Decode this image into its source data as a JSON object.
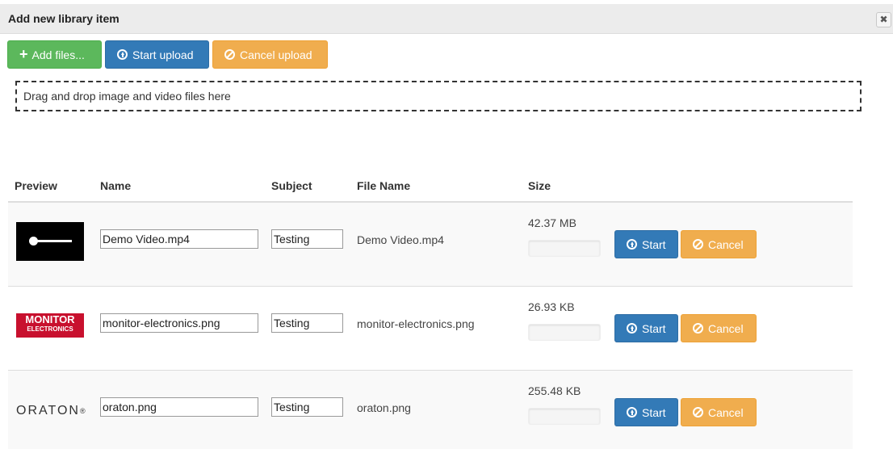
{
  "dialog": {
    "title": "Add new library item",
    "close_glyph": "✖"
  },
  "toolbar": {
    "add_files_label": "Add files...",
    "start_upload_label": "Start upload",
    "cancel_upload_label": "Cancel upload"
  },
  "dropzone": {
    "text": "Drag and drop image and video files here"
  },
  "table": {
    "headers": {
      "preview": "Preview",
      "name": "Name",
      "subject": "Subject",
      "file_name": "File Name",
      "size": "Size"
    },
    "rows": [
      {
        "preview": "video-thumbnail",
        "name": "Demo Video.mp4",
        "subject": "Testing",
        "file_name": "Demo Video.mp4",
        "size": "42.37 MB",
        "progress": 0,
        "start_label": "Start",
        "cancel_label": "Cancel"
      },
      {
        "preview": "monitor-electronics-logo",
        "preview_line1": "MONITOR",
        "preview_line2": "ELECTRONICS",
        "name": "monitor-electronics.png",
        "subject": "Testing",
        "file_name": "monitor-electronics.png",
        "size": "26.93 KB",
        "progress": 0,
        "start_label": "Start",
        "cancel_label": "Cancel"
      },
      {
        "preview": "oraton-logo",
        "preview_text": "ORATON",
        "name": "oraton.png",
        "subject": "Testing",
        "file_name": "oraton.png",
        "size": "255.48 KB",
        "progress": 0,
        "start_label": "Start",
        "cancel_label": "Cancel"
      }
    ]
  },
  "colors": {
    "success": "#5cb85c",
    "primary": "#337ab7",
    "warning": "#f0ad4e"
  }
}
